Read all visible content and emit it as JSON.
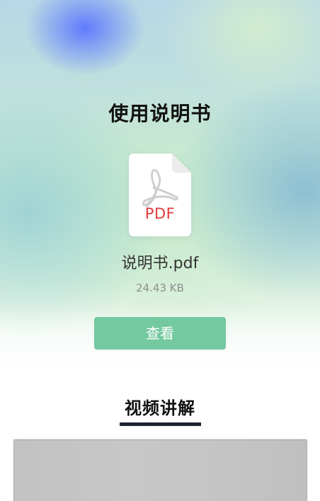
{
  "header": {
    "title": "使用说明书"
  },
  "document": {
    "icon": "pdf-file-icon",
    "icon_label": "PDF",
    "file_name": "说明书.pdf",
    "file_size": "24.43 KB",
    "view_button_label": "查看"
  },
  "video_section": {
    "title": "视频讲解"
  },
  "colors": {
    "button": "#74c9a1",
    "pdf_red": "#e13a3a",
    "title": "#111111",
    "underline": "#1d2430",
    "video_placeholder": "#c5c5c5"
  }
}
